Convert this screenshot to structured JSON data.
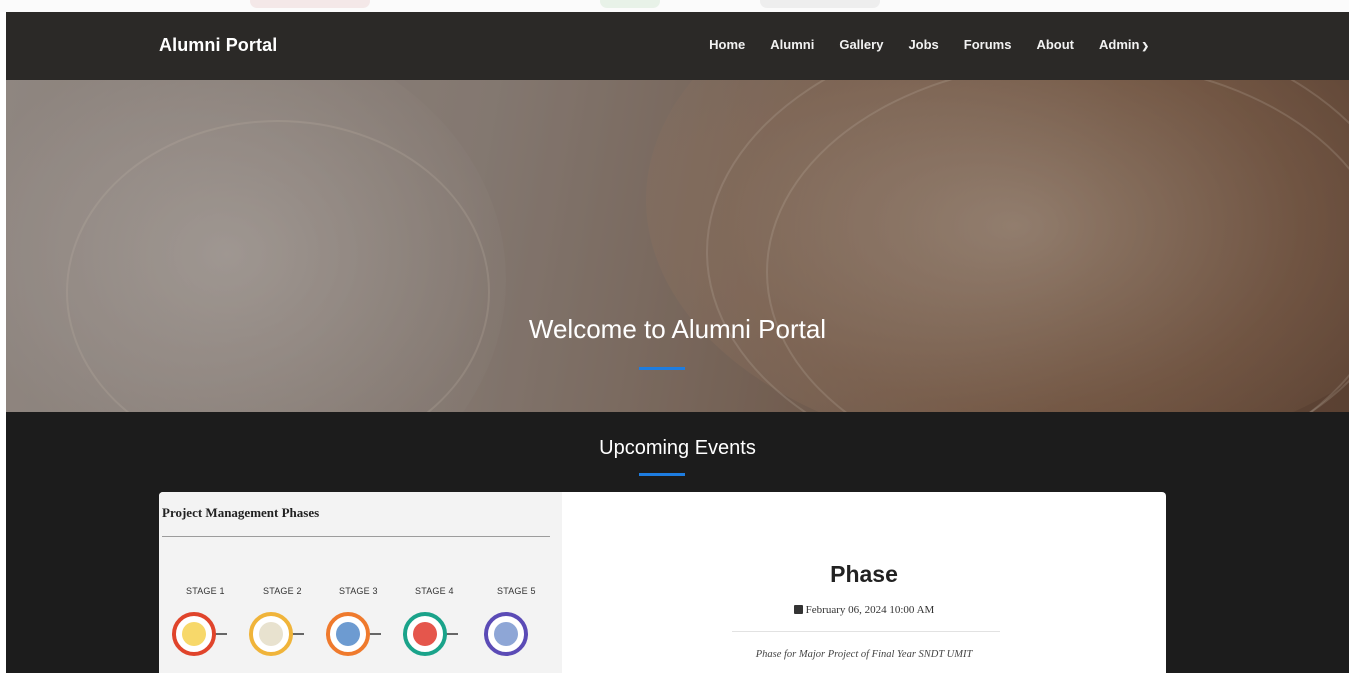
{
  "navbar": {
    "brand": "Alumni Portal",
    "links": [
      "Home",
      "Alumni",
      "Gallery",
      "Jobs",
      "Forums",
      "About",
      "Admin"
    ],
    "admin_dropdown_icon": "chevron-down-icon"
  },
  "hero": {
    "title": "Welcome to Alumni Portal",
    "accent": "#1e7de0"
  },
  "events": {
    "heading": "Upcoming Events",
    "items": [
      {
        "image": {
          "title": "Project Management Phases",
          "stages": [
            "STAGE 1",
            "STAGE 2",
            "STAGE 3",
            "STAGE 4",
            "STAGE 5"
          ],
          "stage_icons": [
            "lightbulb-icon",
            "map-icon",
            "chart-person-icon",
            "brain-icon",
            "handshake-icon"
          ],
          "stage_colors": [
            "#e0442b",
            "#f0b43a",
            "#ef7a2d",
            "#1aa38a",
            "#5b4bb6"
          ]
        },
        "name": "Phase",
        "date_icon": "calendar-icon",
        "date": "February 06, 2024 10:00 AM",
        "description": "Phase for Major Project of Final Year SNDT UMIT"
      }
    ]
  }
}
